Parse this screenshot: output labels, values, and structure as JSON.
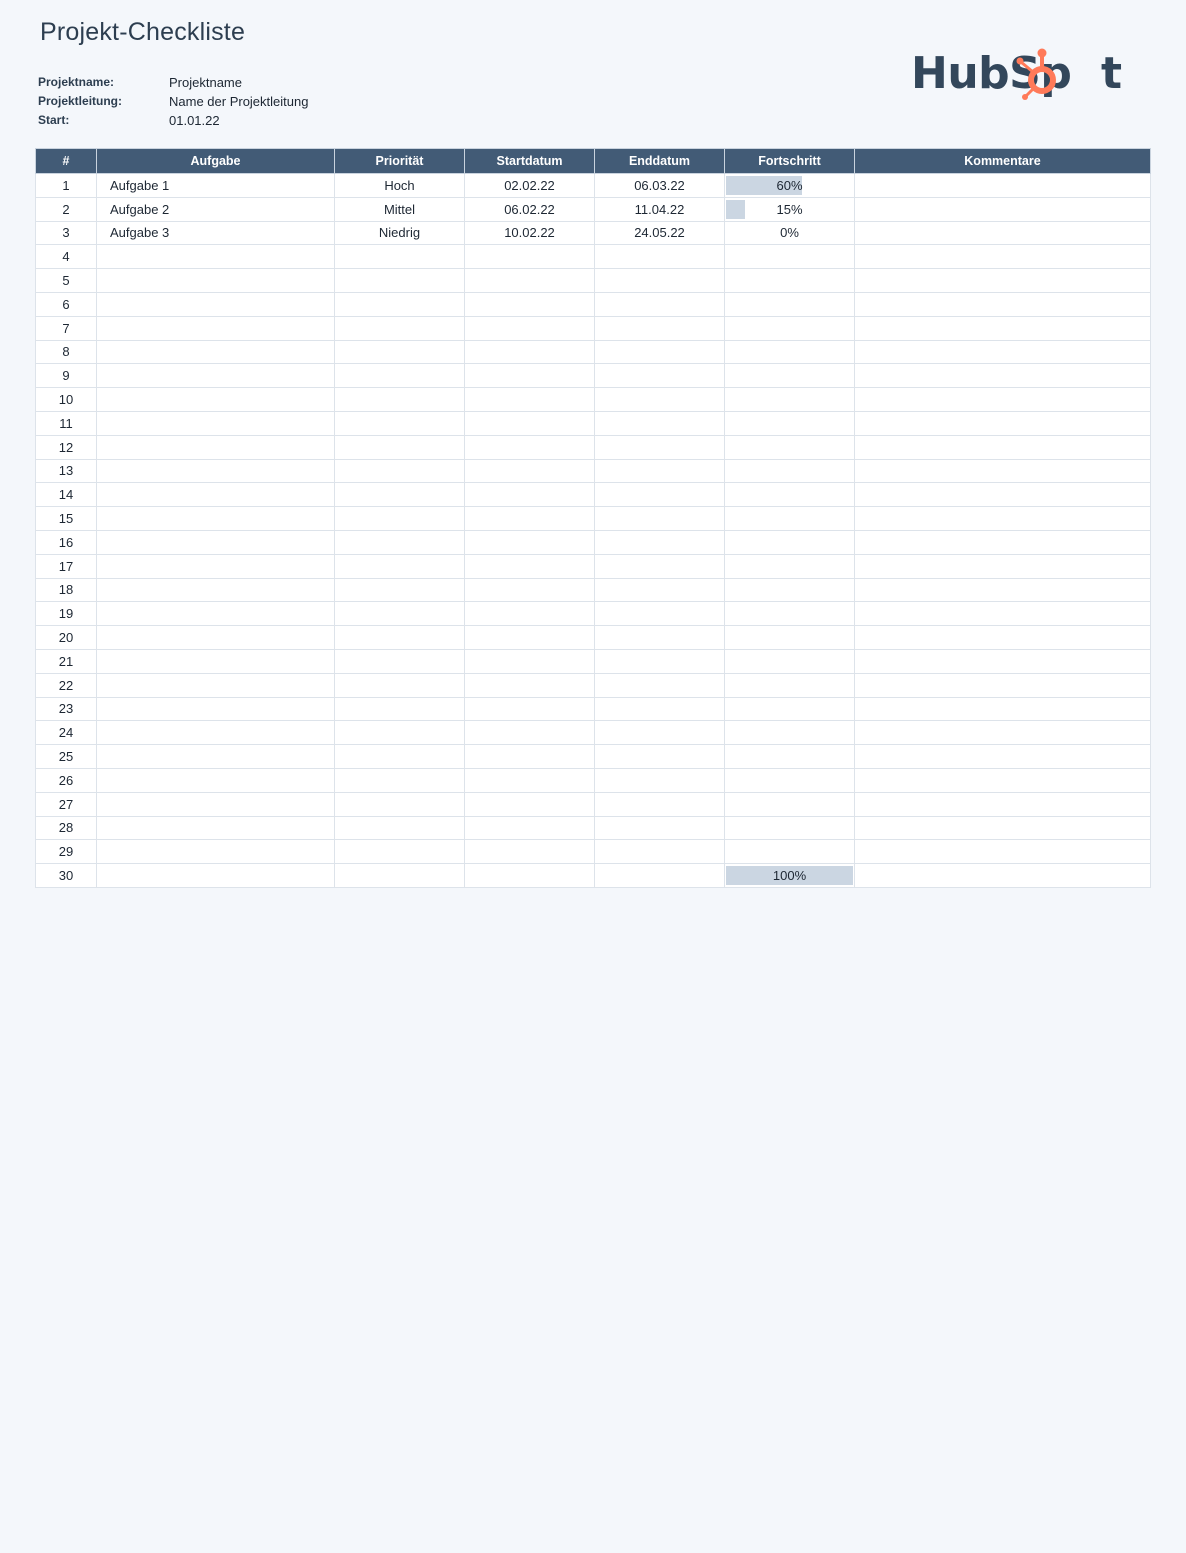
{
  "page": {
    "title": "Projekt-Checkliste"
  },
  "meta": [
    {
      "label": "Projektname:",
      "value": "Projektname"
    },
    {
      "label": "Projektleitung:",
      "value": "Name der Projektleitung"
    },
    {
      "label": "Start:",
      "value": "01.01.22"
    }
  ],
  "logo": {
    "text": "HubSpot",
    "text_color": "#33475b",
    "accent_color": "#ff7a59"
  },
  "colors": {
    "header_bg": "#425b76",
    "progress_fill": "#cbd6e2",
    "priority_high": "#e5544b",
    "priority_medium": "#f0874f",
    "priority_low": "#16a58f"
  },
  "table": {
    "columns": [
      "#",
      "Aufgabe",
      "Priorität",
      "Startdatum",
      "Enddatum",
      "Fortschritt",
      "Kommentare"
    ],
    "rows": [
      {
        "num": "1",
        "task": "Aufgabe 1",
        "priority": "Hoch",
        "priority_level": "hoch",
        "start": "02.02.22",
        "end": "06.03.22",
        "progress": 0.6,
        "progress_label": "60%",
        "comment": ""
      },
      {
        "num": "2",
        "task": "Aufgabe 2",
        "priority": "Mittel",
        "priority_level": "mittel",
        "start": "06.02.22",
        "end": "11.04.22",
        "progress": 0.15,
        "progress_label": "15%",
        "comment": ""
      },
      {
        "num": "3",
        "task": "Aufgabe 3",
        "priority": "Niedrig",
        "priority_level": "niedrig",
        "start": "10.02.22",
        "end": "24.05.22",
        "progress": 0,
        "progress_label": "0%",
        "comment": ""
      },
      {
        "num": "4"
      },
      {
        "num": "5"
      },
      {
        "num": "6"
      },
      {
        "num": "7"
      },
      {
        "num": "8"
      },
      {
        "num": "9"
      },
      {
        "num": "10"
      },
      {
        "num": "11"
      },
      {
        "num": "12"
      },
      {
        "num": "13"
      },
      {
        "num": "14"
      },
      {
        "num": "15"
      },
      {
        "num": "16"
      },
      {
        "num": "17"
      },
      {
        "num": "18"
      },
      {
        "num": "19"
      },
      {
        "num": "20"
      },
      {
        "num": "21"
      },
      {
        "num": "22"
      },
      {
        "num": "23"
      },
      {
        "num": "24"
      },
      {
        "num": "25"
      },
      {
        "num": "26"
      },
      {
        "num": "27"
      },
      {
        "num": "28"
      },
      {
        "num": "29"
      },
      {
        "num": "30",
        "progress": 1,
        "progress_label": "100%"
      }
    ]
  }
}
